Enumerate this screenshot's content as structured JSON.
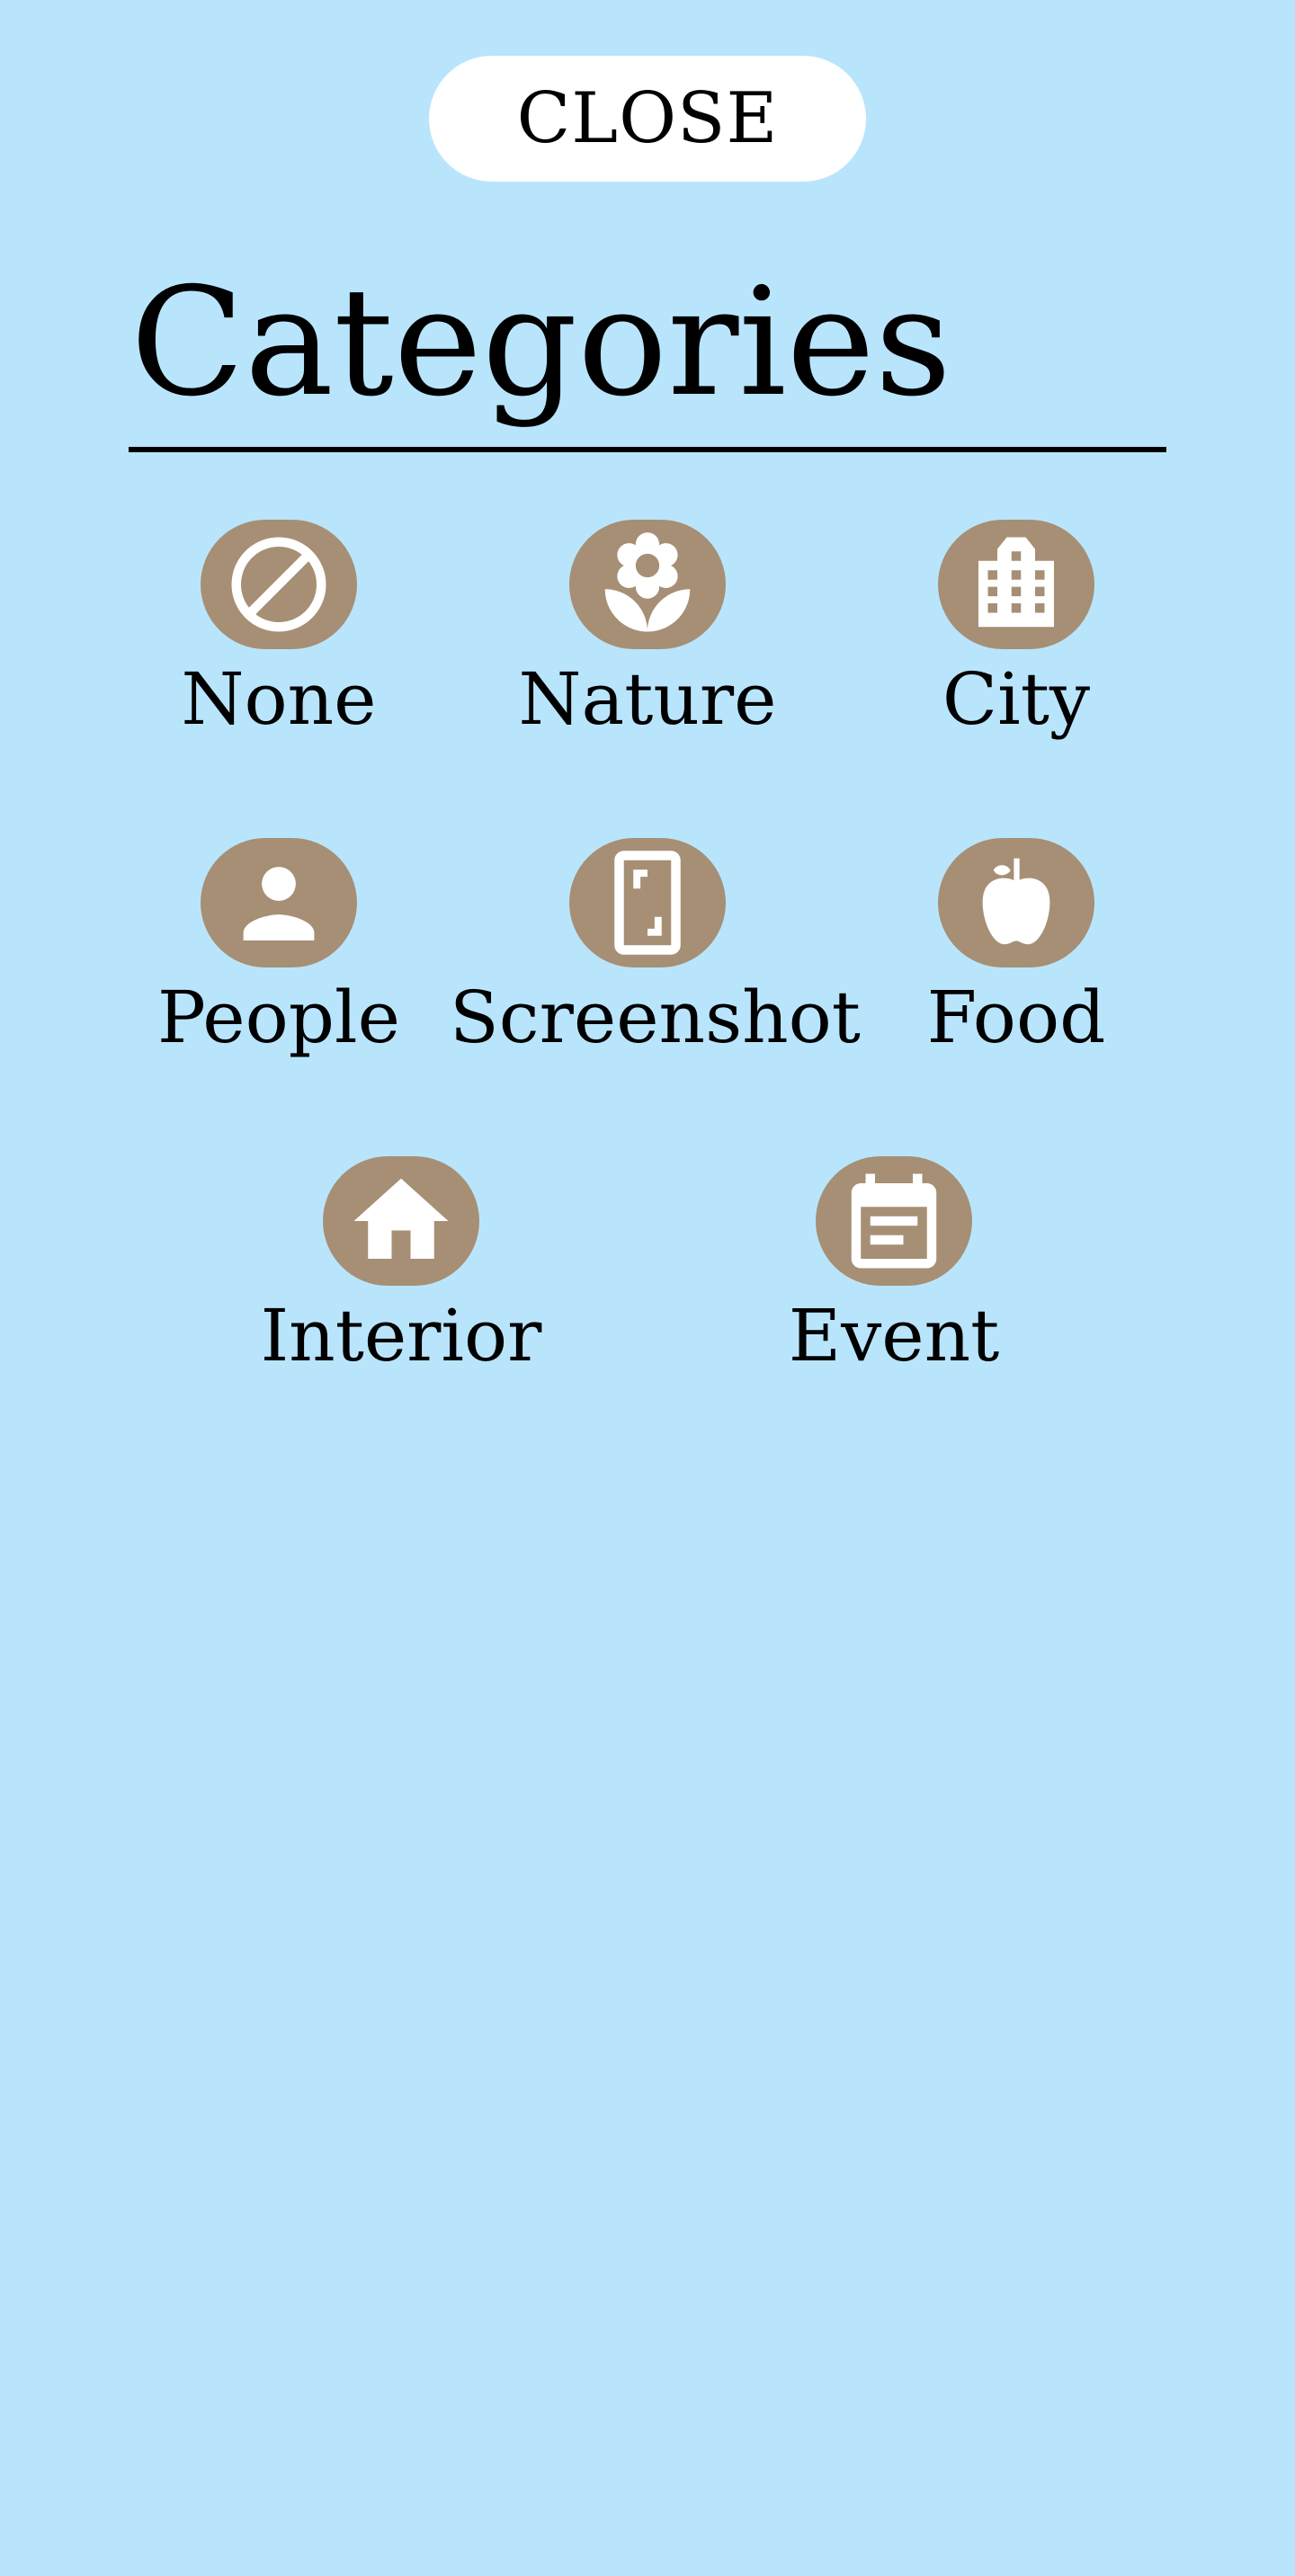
{
  "close_button": {
    "label": "CLOSE"
  },
  "header": {
    "title": "Categories"
  },
  "colors": {
    "background": "#b9e5fc",
    "icon_bubble": "#a68f74",
    "icon_glyph": "#ffffff",
    "button_bg": "#ffffff"
  },
  "categories": [
    {
      "label": "None",
      "icon": "block-icon"
    },
    {
      "label": "Nature",
      "icon": "flower-icon"
    },
    {
      "label": "City",
      "icon": "city-icon"
    },
    {
      "label": "People",
      "icon": "person-icon"
    },
    {
      "label": "Screenshot",
      "icon": "screenshot-icon"
    },
    {
      "label": "Food",
      "icon": "apple-icon"
    },
    {
      "label": "Interior",
      "icon": "home-icon"
    },
    {
      "label": "Event",
      "icon": "event-icon"
    }
  ]
}
